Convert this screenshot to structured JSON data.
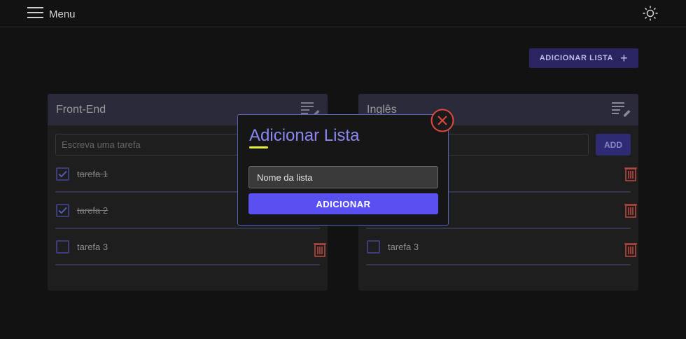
{
  "topbar": {
    "menu_label": "Menu",
    "menu_icon": "hamburger-icon",
    "theme_icon": "sun-icon"
  },
  "toolbar": {
    "add_list_label": "ADICIONAR LISTA",
    "add_list_icon": "plus-icon"
  },
  "lists": [
    {
      "title": "Front-End",
      "input_placeholder": "Escreva uma tarefa",
      "tasks": [
        {
          "text": "tarefa 1",
          "done": true
        },
        {
          "text": "tarefa 2",
          "done": true
        },
        {
          "text": "tarefa 3",
          "done": false
        }
      ]
    },
    {
      "title": "Inglês",
      "input_placeholder": "",
      "add_label": "ADD",
      "tasks": [
        {
          "text": "",
          "done": false
        },
        {
          "text": "",
          "done": false
        },
        {
          "text": "tarefa 3",
          "done": false
        }
      ]
    }
  ],
  "modal": {
    "title": "Adicionar Lista",
    "input_placeholder": "Nome da lista",
    "submit_label": "ADICIONAR",
    "close_icon": "close-circle-icon"
  },
  "colors": {
    "background": "#121212",
    "card": "#1e1e1e",
    "card_header": "#2b2a3b",
    "accent": "#5a4ff0",
    "title_accent": "#8b86f4",
    "underline": "#e6f03a",
    "danger": "#d9534a"
  }
}
